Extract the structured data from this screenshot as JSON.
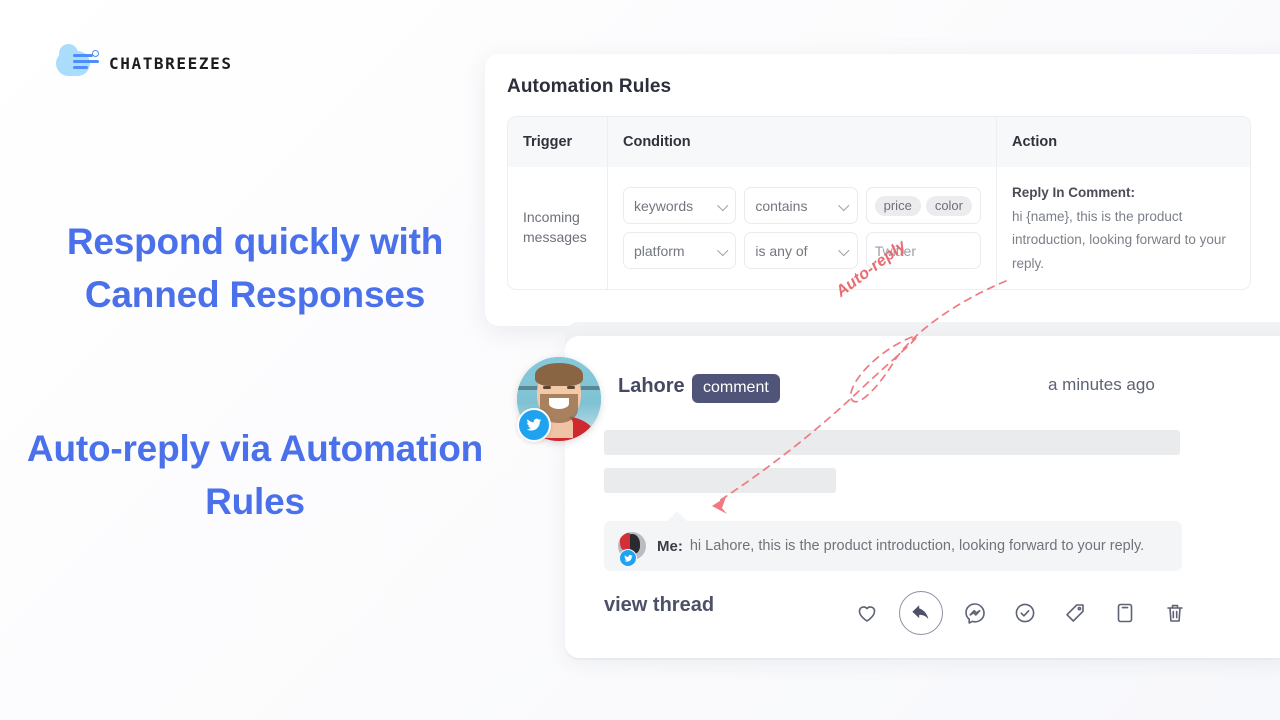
{
  "brand": {
    "logo_text": "CHATBREEZES",
    "accent_blue": "#4a70ea",
    "twitter_blue": "#1fa3f1",
    "annotation_red": "#eb6a6f",
    "tag_slate": "#4f5478"
  },
  "promo": {
    "headline_1": "Respond quickly with Canned Responses",
    "headline_2": "Auto-reply  via Automation Rules"
  },
  "rules": {
    "title": "Automation Rules",
    "columns": {
      "trigger": "Trigger",
      "condition": "Condition",
      "action": "Action"
    },
    "row": {
      "trigger": "Incoming messages",
      "condition_rows": [
        {
          "field": "keywords",
          "operator": "contains",
          "chips": [
            "price",
            "color"
          ],
          "value": ""
        },
        {
          "field": "platform",
          "operator": "is any of",
          "chips": [],
          "value": "Twitter"
        }
      ],
      "action_title": "Reply In Comment:",
      "action_body": "hi {name}, this is the product introduction, looking forward to your reply."
    }
  },
  "comment": {
    "author": "Lahore",
    "type_badge": "comment",
    "timestamp": "a minutes ago",
    "reply": {
      "sender": "Me:",
      "text": "hi Lahore, this is the product introduction, looking forward to your reply."
    },
    "view_thread_label": "view thread",
    "actions": [
      {
        "name": "like-icon",
        "label": "Like"
      },
      {
        "name": "reply-icon",
        "label": "Reply"
      },
      {
        "name": "messenger-icon",
        "label": "Messenger"
      },
      {
        "name": "mark-done-icon",
        "label": "Mark done"
      },
      {
        "name": "tag-icon",
        "label": "Tag"
      },
      {
        "name": "save-icon",
        "label": "Save"
      },
      {
        "name": "delete-icon",
        "label": "Delete"
      }
    ]
  },
  "annotation": {
    "label": "Auto-reply"
  }
}
